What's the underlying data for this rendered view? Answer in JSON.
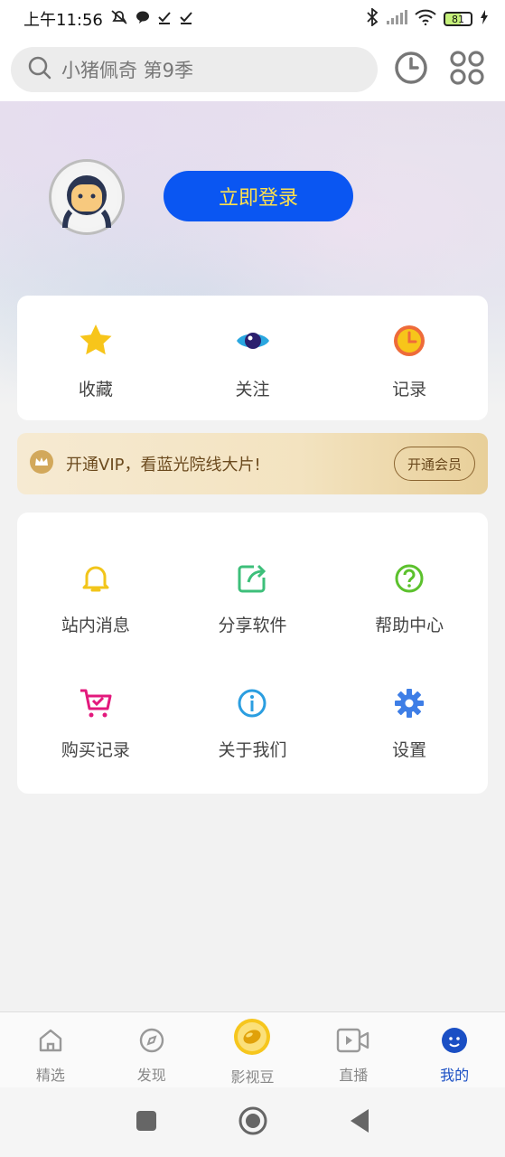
{
  "status_bar": {
    "time": "上午11:56",
    "battery": "81"
  },
  "search": {
    "placeholder": "小猪佩奇 第9季"
  },
  "header_icons": [
    "history-icon",
    "apps-grid-icon"
  ],
  "login": {
    "button_label": "立即登录"
  },
  "quick_actions": [
    {
      "label": "收藏",
      "icon": "star-icon"
    },
    {
      "label": "关注",
      "icon": "eye-icon"
    },
    {
      "label": "记录",
      "icon": "clock-icon"
    }
  ],
  "vip": {
    "text": "开通VIP，看蓝光院线大片!",
    "button_label": "开通会员"
  },
  "menu": [
    {
      "label": "站内消息",
      "icon": "bell-icon"
    },
    {
      "label": "分享软件",
      "icon": "share-icon"
    },
    {
      "label": "帮助中心",
      "icon": "help-icon"
    },
    {
      "label": "购买记录",
      "icon": "cart-icon"
    },
    {
      "label": "关于我们",
      "icon": "info-icon"
    },
    {
      "label": "设置",
      "icon": "gear-icon"
    }
  ],
  "bottom_nav": [
    {
      "label": "精选",
      "icon": "home-icon"
    },
    {
      "label": "发现",
      "icon": "compass-icon"
    },
    {
      "label": "影视豆",
      "icon": "bean-icon"
    },
    {
      "label": "直播",
      "icon": "video-icon"
    },
    {
      "label": "我的",
      "icon": "profile-icon",
      "active": true
    }
  ],
  "colors": {
    "accent": "#0a56f2",
    "login_text": "#ffe14d",
    "active_nav": "#1a4fc4"
  }
}
